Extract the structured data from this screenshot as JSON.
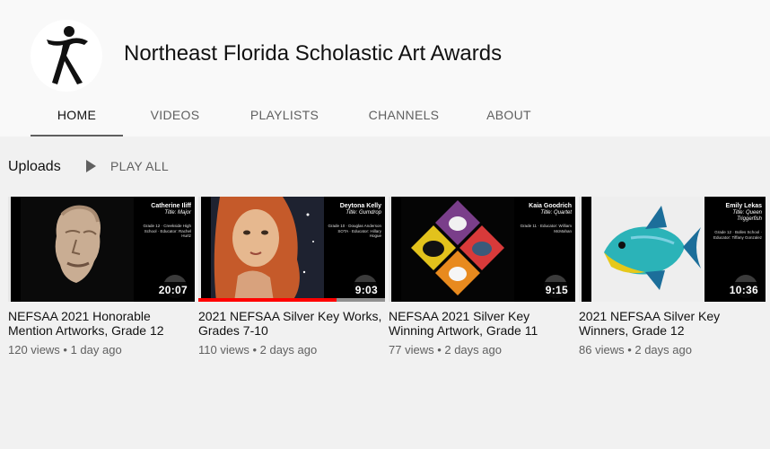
{
  "channel": {
    "name": "Northeast Florida Scholastic Art Awards"
  },
  "tabs": [
    {
      "label": "HOME"
    },
    {
      "label": "VIDEOS"
    },
    {
      "label": "PLAYLISTS"
    },
    {
      "label": "CHANNELS"
    },
    {
      "label": "ABOUT"
    }
  ],
  "uploads": {
    "title": "Uploads",
    "play_all": "PLAY ALL"
  },
  "videos": [
    {
      "title": "NEFSAA 2021 Honorable Mention Artworks, Grade 12",
      "views": "120 views",
      "age": "1 day ago",
      "duration": "20:07",
      "thumb_name": "Catherine Iliff",
      "thumb_title": "Title: Major",
      "thumb_info": "Grade 12 · Creekside High School · Educator: Rachel Hurtz",
      "watched_fraction": 0
    },
    {
      "title": "2021 NEFSAA Silver Key Works, Grades 7-10",
      "views": "110 views",
      "age": "2 days ago",
      "duration": "9:03",
      "thumb_name": "Deytona Kelly",
      "thumb_title": "Title: Gumdrop",
      "thumb_info": "Grade 10 · Douglas Anderson SOTA · Educator: Hillary Hogue",
      "watched_fraction": 0.74
    },
    {
      "title": "NEFSAA 2021 Silver Key Winning Artwork, Grade 11",
      "views": "77 views",
      "age": "2 days ago",
      "duration": "9:15",
      "thumb_name": "Kaia Goodrich",
      "thumb_title": "Title: Quartet",
      "thumb_info": "Grade 11 · Educator: William McMahan",
      "watched_fraction": 0
    },
    {
      "title": "2021 NEFSAA Silver Key Winners, Grade 12",
      "views": "86 views",
      "age": "2 days ago",
      "duration": "10:36",
      "thumb_name": "Emily Lekas",
      "thumb_title": "Title: Queen Triggerfish",
      "thumb_info": "Grade 12 · Bolles School · Educator: Tiffany Gonzalez",
      "watched_fraction": 0
    }
  ],
  "colors": {
    "header_bg": "#f9f9f9",
    "page_bg": "#f1f1f1",
    "progress": "#ff0000",
    "muted_text": "#606060"
  }
}
